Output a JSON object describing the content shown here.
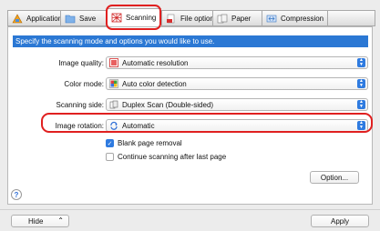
{
  "tabs": [
    {
      "label": "Application",
      "icon": "application-icon"
    },
    {
      "label": "Save",
      "icon": "save-folder-icon"
    },
    {
      "label": "Scanning",
      "icon": "scanning-icon",
      "active": true
    },
    {
      "label": "File option",
      "icon": "file-option-icon"
    },
    {
      "label": "Paper",
      "icon": "paper-icon"
    },
    {
      "label": "Compression",
      "icon": "compression-icon"
    }
  ],
  "banner": "Specify the scanning mode and options you would like to use.",
  "fields": {
    "image_quality": {
      "label": "Image quality:",
      "value": "Automatic resolution",
      "icon": "image-quality-icon"
    },
    "color_mode": {
      "label": "Color mode:",
      "value": "Auto color detection",
      "icon": "color-mode-icon"
    },
    "scanning_side": {
      "label": "Scanning side:",
      "value": "Duplex Scan (Double-sided)",
      "icon": "duplex-icon"
    },
    "image_rotation": {
      "label": "Image rotation:",
      "value": "Automatic",
      "icon": "rotation-icon"
    }
  },
  "options": {
    "blank_page_removal": {
      "label": "Blank page removal",
      "checked": true
    },
    "continue_scanning": {
      "label": "Continue scanning after last page",
      "checked": false
    }
  },
  "buttons": {
    "option": "Option...",
    "hide": "Hide",
    "apply": "Apply",
    "help": "?"
  },
  "colors": {
    "accent": "#2b78d4",
    "highlight": "#e02020"
  }
}
